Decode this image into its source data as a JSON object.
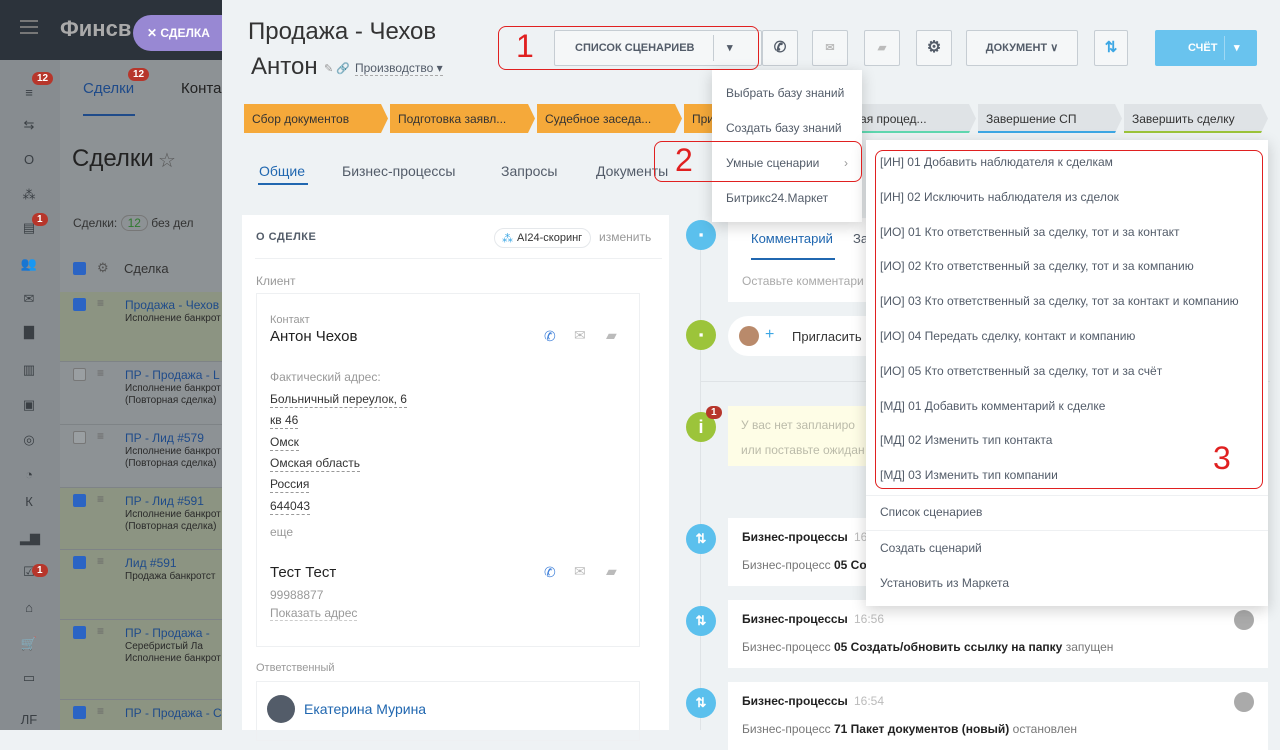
{
  "app": {
    "brand": "Финсв",
    "slider_label": "СДЕЛКА"
  },
  "sidebar_badges": {
    "filter": "12",
    "calendar": "1",
    "tasks": "1"
  },
  "sidebar_letters": {
    "o": "О",
    "k": "К",
    "lf": "ЛF"
  },
  "list": {
    "tab_deals": "Сделки",
    "tab_deals_badge": "12",
    "tab_contacts": "Конта",
    "page_title": "Сделки",
    "counter_label": "Сделки:",
    "counter_value": "12",
    "counter_suffix": "без дел",
    "col_header": "Сделка",
    "rows": [
      {
        "title": "Продажа - Чехов",
        "sub": "Исполнение банкрот",
        "sub2": "",
        "checked": true
      },
      {
        "title": "ПР - Продажа - L",
        "sub": "Исполнение банкрот",
        "sub2": "(Повторная сделка)",
        "checked": false
      },
      {
        "title": "ПР - Лид #579",
        "sub": "Исполнение банкрот",
        "sub2": "(Повторная сделка)",
        "checked": false
      },
      {
        "title": "ПР - Лид #591",
        "sub": "Исполнение банкрот",
        "sub2": "(Повторная сделка)",
        "checked": true
      },
      {
        "title": "Лид #591",
        "sub": "Продажа банкротст",
        "sub2": "",
        "checked": true
      },
      {
        "title": "ПР - Продажа -",
        "sub": "Серебристый Ла",
        "sub2": "Исполнение банкрот",
        "checked": true
      },
      {
        "title": "ПР - Продажа - С",
        "sub": "",
        "sub2": "",
        "checked": true
      }
    ]
  },
  "deal": {
    "title_line1": "Продажа - Чехов",
    "title_line2": "Антон",
    "pipeline": "Производство"
  },
  "toolbar": {
    "scenarios": "СПИСОК СЦЕНАРИЕВ",
    "document": "ДОКУМЕНТ",
    "invoice": "СЧЁТ"
  },
  "stages": [
    {
      "label": "Сбор документов",
      "color": "#f5a93a"
    },
    {
      "label": "Подготовка заявл...",
      "color": "#f5a93a"
    },
    {
      "label": "Судебное заседа...",
      "color": "#f5a93a"
    },
    {
      "label": "При",
      "color": "#f5a93a"
    },
    {
      "label": "ебная процед...",
      "color": "#dfe3e6"
    },
    {
      "label": "Завершение СП",
      "color": "#dfe3e6"
    },
    {
      "label": "Завершить сделку",
      "color": "#dfe3e6"
    }
  ],
  "tabs": [
    "Общие",
    "Бизнес-процессы",
    "Запросы",
    "Документы"
  ],
  "about": {
    "header": "О СДЕЛКЕ",
    "scoring": "AI24-скоринг",
    "edit": "изменить",
    "client_label": "Клиент",
    "contact_label": "Контакт",
    "contact_name": "Антон Чехов",
    "address_label": "Фактический адрес:",
    "address": [
      "Больничный переулок, 6",
      "кв 46",
      "Омск",
      "Омская область",
      "Россия",
      "644043"
    ],
    "more": "еще",
    "contact2_name": "Тест Тест",
    "contact2_phone": "99988877",
    "show_address": "Показать адрес",
    "responsible_label": "Ответственный",
    "responsible_name": "Екатерина Мурина"
  },
  "timeline": {
    "tab_comment": "Комментарий",
    "tab_next": "За",
    "comment_placeholder": "Оставьте комментари",
    "invite": "Пригласить",
    "notice_line1": "У вас нет запланиро",
    "notice_line2": "или поставьте ожидан",
    "notice_badge": "1",
    "events": [
      {
        "title": "Бизнес-процессы",
        "time": "16",
        "prefix": "Бизнес-процесс",
        "bold": "05 Со",
        "suffix": ""
      },
      {
        "title": "Бизнес-процессы",
        "time": "16:56",
        "prefix": "Бизнес-процесс",
        "bold": "05 Создать/обновить ссылку на папку",
        "suffix": "запущен"
      },
      {
        "title": "Бизнес-процессы",
        "time": "16:54",
        "prefix": "Бизнес-процесс",
        "bold": "71 Пакет документов (новый)",
        "suffix": "остановлен"
      }
    ]
  },
  "menu": [
    "Выбрать базу знаний",
    "Создать базу знаний",
    "Умные сценарии",
    "Битрикс24.Маркет"
  ],
  "submenu": {
    "items": [
      "[ИН] 01 Добавить наблюдателя к сделкам",
      "[ИН] 02 Исключить наблюдателя из сделок",
      "[ИО] 01 Кто ответственный за сделку, тот и за контакт",
      "[ИО] 02 Кто ответственный за сделку, тот и за компанию",
      "[ИО] 03 Кто ответственный за сделку, тот за контакт и компанию",
      "[ИО] 04 Передать сделку, контакт и компанию",
      "[ИО] 05 Кто ответственный за сделку, тот и за счёт",
      "[МД] 01 Добавить комментарий к сделке",
      "[МД] 02 Изменить тип контакта",
      "[МД] 03 Изменить тип компании"
    ],
    "footer": [
      "Список сценариев",
      "Создать сценарий",
      "Установить из Маркета"
    ]
  },
  "annotations": [
    "1",
    "2",
    "3"
  ]
}
